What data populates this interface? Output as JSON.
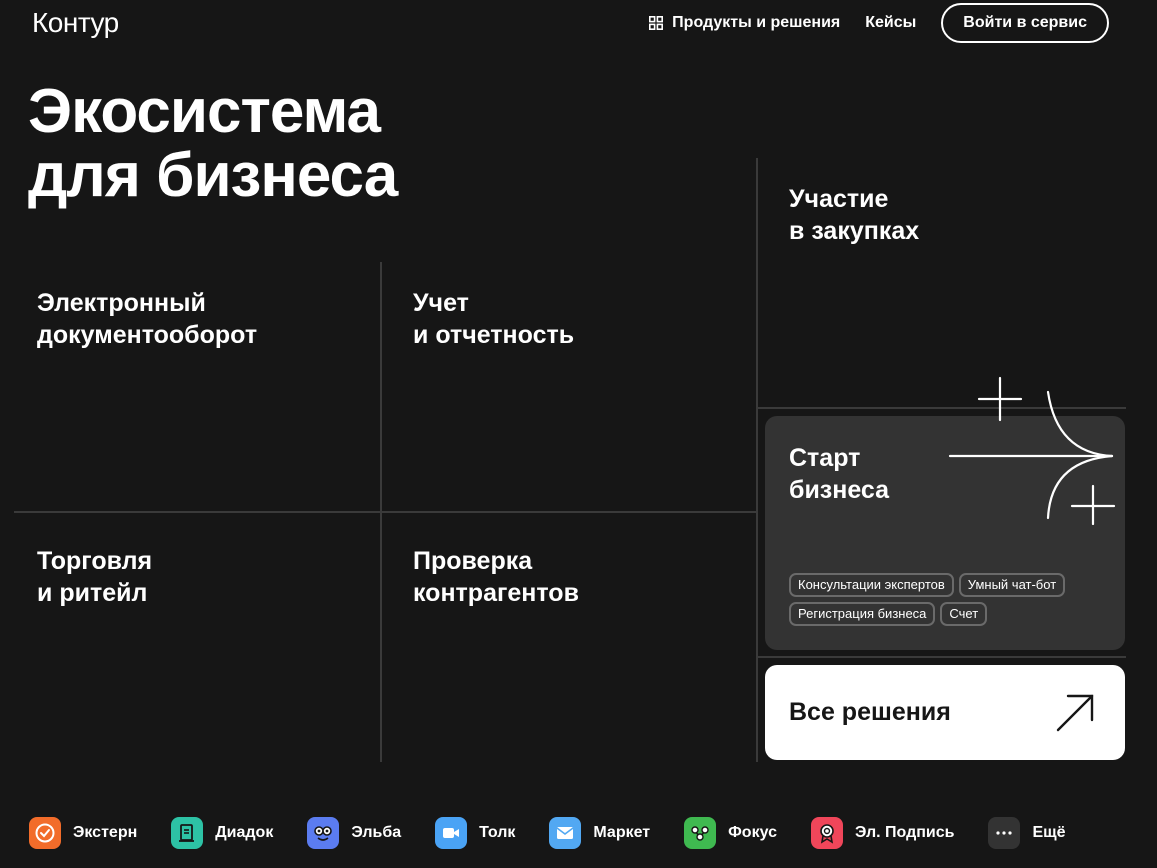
{
  "header": {
    "logo": "Контур",
    "products_label": "Продукты и решения",
    "cases_label": "Кейсы",
    "login_label": "Войти в сервис"
  },
  "hero": {
    "title_line1": "Экосистема",
    "title_line2": "для бизнеса"
  },
  "tiles": {
    "procurement": {
      "line1": "Участие",
      "line2": "в закупках"
    },
    "edo": {
      "line1": "Электронный",
      "line2": "документооборот"
    },
    "accounting": {
      "line1": "Учет",
      "line2": "и отчетность"
    },
    "trade": {
      "line1": "Торговля",
      "line2": "и ритейл"
    },
    "check": {
      "line1": "Проверка",
      "line2": "контрагентов"
    },
    "start": {
      "line1": "Старт",
      "line2": "бизнеса",
      "tags": [
        "Консультации экспертов",
        "Умный чат-бот",
        "Регистрация бизнеса",
        "Счет"
      ]
    },
    "all": {
      "label": "Все решения"
    }
  },
  "products": [
    {
      "name": "Экстерн",
      "icon": "check-icon",
      "color": "#f26c2a"
    },
    {
      "name": "Диадок",
      "icon": "document-icon",
      "color": "#2dc2a5"
    },
    {
      "name": "Эльба",
      "icon": "face-icon",
      "color": "#5b7cf0"
    },
    {
      "name": "Толк",
      "icon": "video-camera-icon",
      "color": "#4aa3f5"
    },
    {
      "name": "Маркет",
      "icon": "envelope-icon",
      "color": "#52a8f2"
    },
    {
      "name": "Фокус",
      "icon": "graph-icon",
      "color": "#3fb950"
    },
    {
      "name": "Эл. Подпись",
      "icon": "seal-icon",
      "color": "#f0465a"
    },
    {
      "name": "Ещё",
      "icon": "more-icon",
      "color": "#333333"
    }
  ]
}
